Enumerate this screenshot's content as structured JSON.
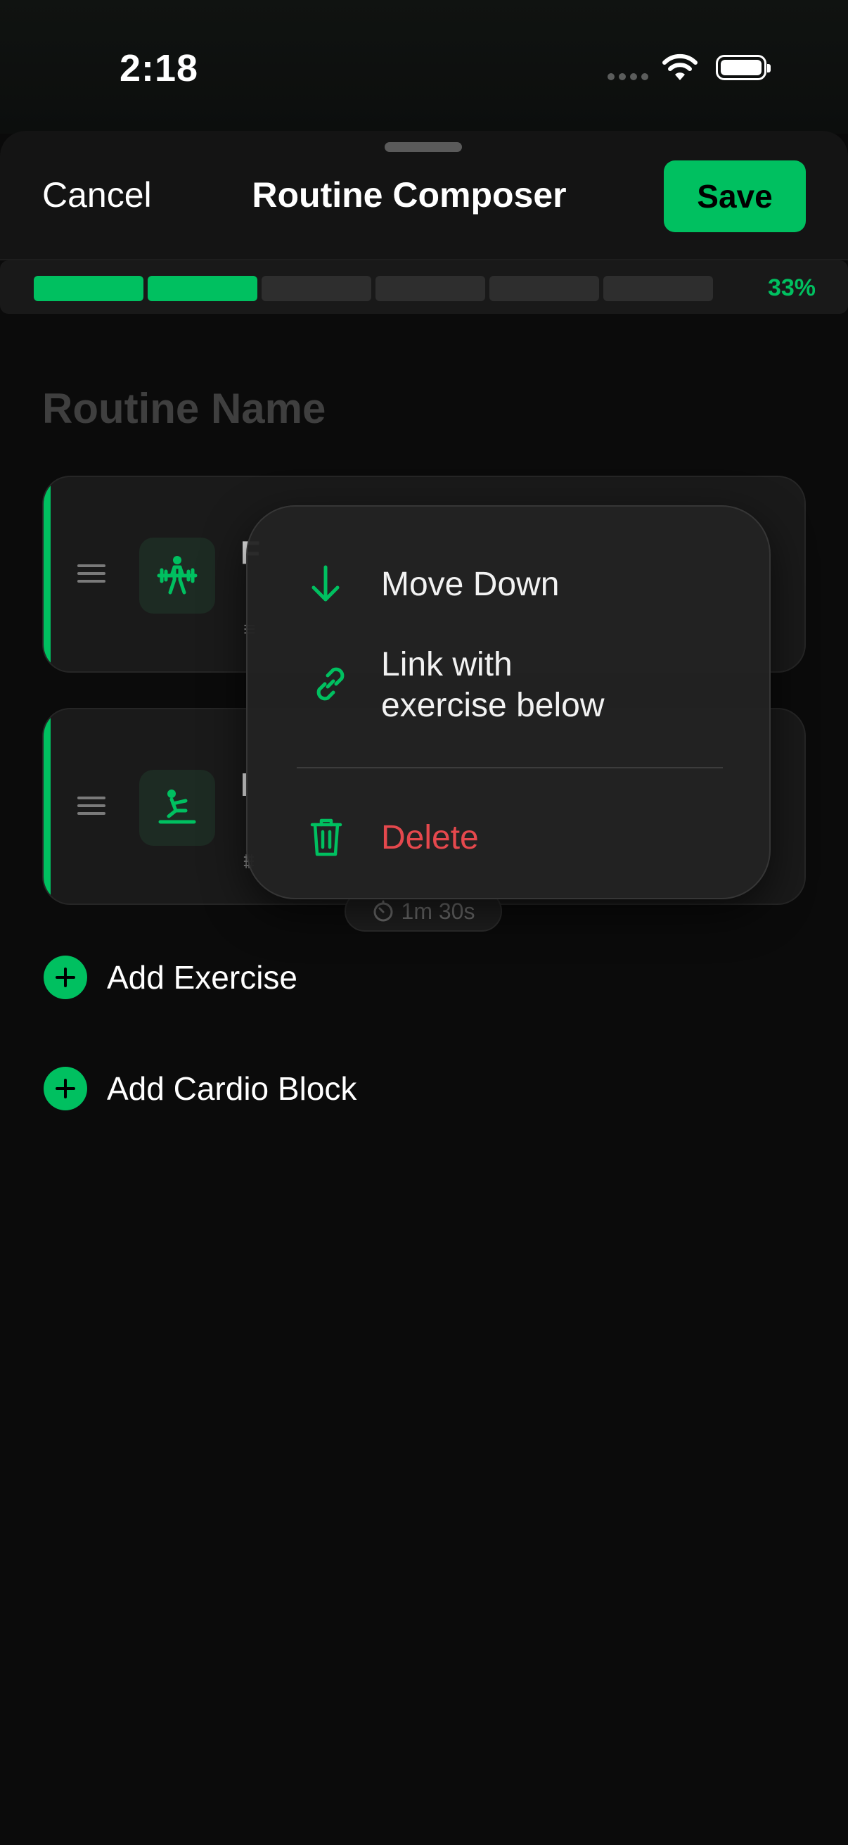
{
  "status_bar": {
    "time": "2:18",
    "icons": [
      "signal-dots-icon",
      "wifi-icon",
      "battery-icon"
    ]
  },
  "header": {
    "cancel_label": "Cancel",
    "title": "Routine Composer",
    "save_label": "Save"
  },
  "progress": {
    "segments_total": 6,
    "segments_filled": 2,
    "percent_label": "33%",
    "percent": 33
  },
  "routine_name": {
    "placeholder": "Routine Name",
    "value": ""
  },
  "exercises": [
    {
      "icon": "weightlifting-icon",
      "title_visible": "F",
      "meta_visible": "≡"
    },
    {
      "icon": "rowing-icon",
      "title_visible": "I",
      "meta_visible": "⩩"
    }
  ],
  "rest_chip": {
    "icon": "timer-icon",
    "label": "1m 30s"
  },
  "add_actions": {
    "add_exercise": "Add Exercise",
    "add_cardio": "Add Cardio Block"
  },
  "context_menu": {
    "items": [
      {
        "label": "Move Down",
        "icon": "arrow-down-icon"
      },
      {
        "label": "Link with\nexercise below",
        "icon": "link-icon"
      },
      {
        "label": "Delete",
        "icon": "trash-icon"
      }
    ]
  },
  "colors": {
    "accent": "#00c060",
    "danger": "#e5484d",
    "background": "#0b0b0b",
    "card": "#1a1a1a"
  }
}
